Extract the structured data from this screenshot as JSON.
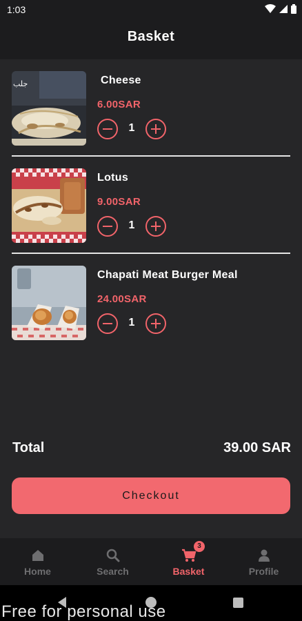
{
  "status_bar": {
    "time": "1:03"
  },
  "header": {
    "title": "Basket"
  },
  "items": [
    {
      "name": "Cheese",
      "price": "6.00SAR",
      "quantity": "1",
      "image": "cheese-wrap-photo",
      "image_overlay_text": "ﺟﻠﺐ"
    },
    {
      "name": "Lotus",
      "price": "9.00SAR",
      "quantity": "1",
      "image": "lotus-wrap-photo"
    },
    {
      "name": "Chapati Meat Burger Meal",
      "price": "24.00SAR",
      "quantity": "1",
      "image": "burger-meal-photo"
    }
  ],
  "total": {
    "label": "Total",
    "value": "39.00 SAR"
  },
  "checkout": {
    "label": "Checkout"
  },
  "nav": {
    "items": [
      {
        "label": "Home",
        "icon": "home-icon",
        "active": false
      },
      {
        "label": "Search",
        "icon": "search-icon",
        "active": false
      },
      {
        "label": "Basket",
        "icon": "cart-icon",
        "active": true,
        "badge": "3"
      },
      {
        "label": "Profile",
        "icon": "person-icon",
        "active": false
      }
    ]
  },
  "watermark": "Free for personal use",
  "colors": {
    "accent": "#f2646a",
    "background": "#262628",
    "bar": "#1c1c1e",
    "inactive": "#6e6e70"
  }
}
